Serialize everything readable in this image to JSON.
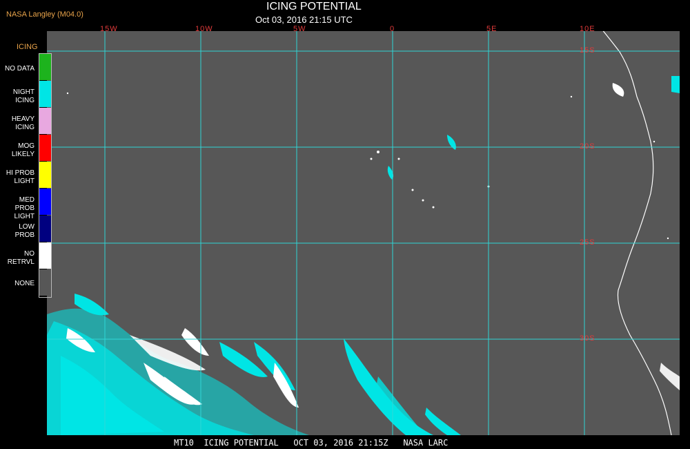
{
  "header": {
    "source": "NASA Langley (M04.0)",
    "title": "ICING POTENTIAL",
    "datetime": "Oct 03, 2016 21:15 UTC"
  },
  "legend": {
    "title": "ICING",
    "items": [
      {
        "label": "NO DATA",
        "color": "#1db31d"
      },
      {
        "label": "NIGHT ICING",
        "color": "#00e5e5"
      },
      {
        "label": "HEAVY ICING",
        "color": "#e8a8e0"
      },
      {
        "label": "MOG LIKELY",
        "color": "#ff0000"
      },
      {
        "label": "HI PROB LIGHT",
        "color": "#ffff00"
      },
      {
        "label": "MED PROB LIGHT",
        "color": "#0000ff"
      },
      {
        "label": "LOW PROB",
        "color": "#000080"
      },
      {
        "label": "NO RETRVL",
        "color": "#ffffff"
      },
      {
        "label": "NONE",
        "color": "#575757"
      }
    ]
  },
  "graticule": {
    "longitude_labels": [
      "15W",
      "10W",
      "5W",
      "0",
      "5E",
      "10E"
    ],
    "latitude_labels": [
      "15S",
      "20S",
      "25S",
      "30S"
    ]
  },
  "footer": {
    "text": "MT10  ICING POTENTIAL   OCT 03, 2016 21:15Z   NASA LARC"
  },
  "colors": {
    "background": "#000000",
    "map_fill": "#575757",
    "grid": "#2fd6d6",
    "labels": "#e23b3b",
    "icing": "#00e5e5",
    "no_retrieval": "#ffffff"
  }
}
